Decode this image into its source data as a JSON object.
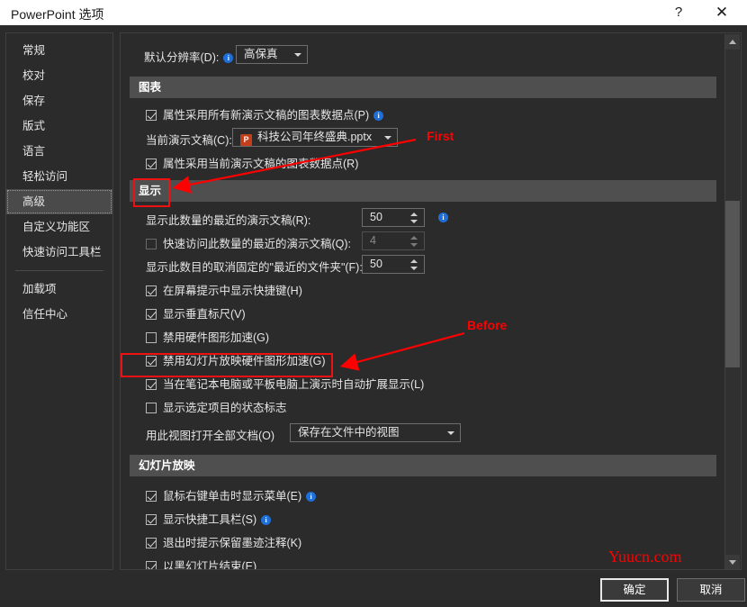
{
  "window": {
    "title": "PowerPoint 选项",
    "help_icon": "?",
    "close_icon": "✕"
  },
  "sidebar": {
    "items": [
      {
        "label": "常规",
        "selected": false
      },
      {
        "label": "校对",
        "selected": false
      },
      {
        "label": "保存",
        "selected": false
      },
      {
        "label": "版式",
        "selected": false
      },
      {
        "label": "语言",
        "selected": false
      },
      {
        "label": "轻松访问",
        "selected": false
      },
      {
        "label": "高级",
        "selected": true
      },
      {
        "label": "自定义功能区",
        "selected": false
      },
      {
        "label": "快速访问工具栏",
        "selected": false
      },
      {
        "label": "加载项",
        "selected": false
      },
      {
        "label": "信任中心",
        "selected": false
      }
    ]
  },
  "pane": {
    "default_resolution": {
      "label": "默认分辨率(D):",
      "value": "高保真"
    },
    "chart_section": {
      "header": "图表",
      "opt_all_new": "属性采用所有新演示文稿的图表数据点(P)",
      "current_doc_label": "当前演示文稿(C):",
      "current_doc_value": "科技公司年终盛典.pptx",
      "current_doc_icon": "P",
      "opt_current": "属性采用当前演示文稿的图表数据点(R)"
    },
    "display_section": {
      "header": "显示",
      "recent_presentations_label": "显示此数量的最近的演示文稿(R):",
      "recent_presentations_value": "50",
      "quick_access_label": "快速访问此数量的最近的演示文稿(Q):",
      "quick_access_value": "4",
      "recent_folders_label": "显示此数目的取消固定的\"最近的文件夹\"(F):",
      "recent_folders_value": "50",
      "opt_shortcut_keys": "在屏幕提示中显示快捷键(H)",
      "opt_vertical_ruler": "显示垂直标尺(V)",
      "opt_disable_hw_accel": "禁用硬件图形加速(G)",
      "opt_disable_slideshow_hw_accel": "禁用幻灯片放映硬件图形加速(G)",
      "opt_auto_extend": "当在笔记本电脑或平板电脑上演示时自动扩展显示(L)",
      "opt_status_flags": "显示选定项目的状态标志",
      "open_view_label": "用此视图打开全部文档(O)",
      "open_view_value": "保存在文件中的视图"
    },
    "slideshow_section": {
      "header": "幻灯片放映",
      "opt_right_click_menu": "鼠标右键单击时显示菜单(E)",
      "opt_quick_toolbar": "显示快捷工具栏(S)",
      "opt_keep_ink": "退出时提示保留墨迹注释(K)",
      "opt_end_black": "以黑幻灯片结束(E)"
    }
  },
  "footer": {
    "ok_label": "确定",
    "cancel_label": "取消"
  },
  "annotations": {
    "first_label": "First",
    "before_label": "Before",
    "watermark": "Yuucn.com",
    "accent_color": "#ff0000"
  }
}
